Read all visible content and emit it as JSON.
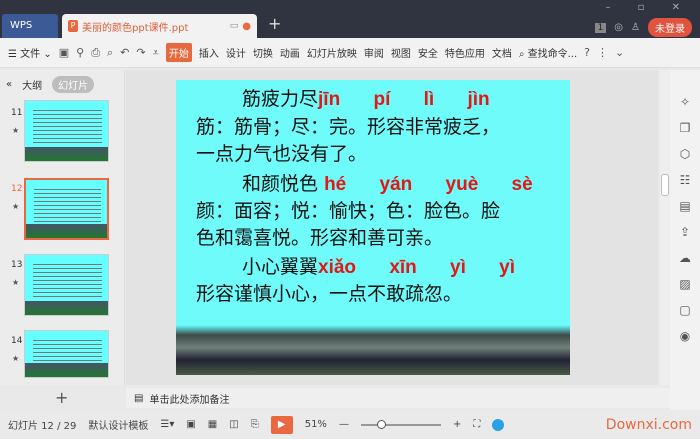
{
  "window": {
    "app": "WPS",
    "tab_title": "美丽的颜色ppt课件.ppt",
    "login": "未登录",
    "badge": "1"
  },
  "toolbar": {
    "file": "文件",
    "tabs": [
      "开始",
      "插入",
      "设计",
      "切换",
      "动画",
      "幻灯片放映",
      "审阅",
      "视图",
      "安全",
      "特色应用",
      "文档"
    ],
    "search": "查找命令..."
  },
  "left": {
    "tab_outline": "大纲",
    "tab_slides": "幻灯片",
    "slides": [
      {
        "num": "11"
      },
      {
        "num": "12"
      },
      {
        "num": "13"
      },
      {
        "num": "14"
      }
    ]
  },
  "slide": {
    "lines": [
      {
        "text": "筋疲力尽",
        "pinyin": "jīn pí lì jìn"
      },
      {
        "text": "筋：筋骨；尽：完。形容非常疲乏，"
      },
      {
        "text": "一点力气也没有了。"
      },
      {
        "text": "和颜悦色",
        "pinyin": "hé yán yuè sè"
      },
      {
        "text": "颜：面容；悦：愉快；色：脸色。脸"
      },
      {
        "text": "色和霭喜悦。形容和善可亲。"
      },
      {
        "text": "小心翼翼",
        "pinyin": "xiǎo xīn yì yì"
      },
      {
        "text": "形容谨慎小心，一点不敢疏忽。"
      }
    ]
  },
  "notes": {
    "placeholder": "单击此处添加备注"
  },
  "status": {
    "slide_counter": "幻灯片 12 / 29",
    "template": "默认设计模板",
    "zoom": "51%",
    "brand": "Downxi.com",
    "zoom_fraction": 0.25
  }
}
